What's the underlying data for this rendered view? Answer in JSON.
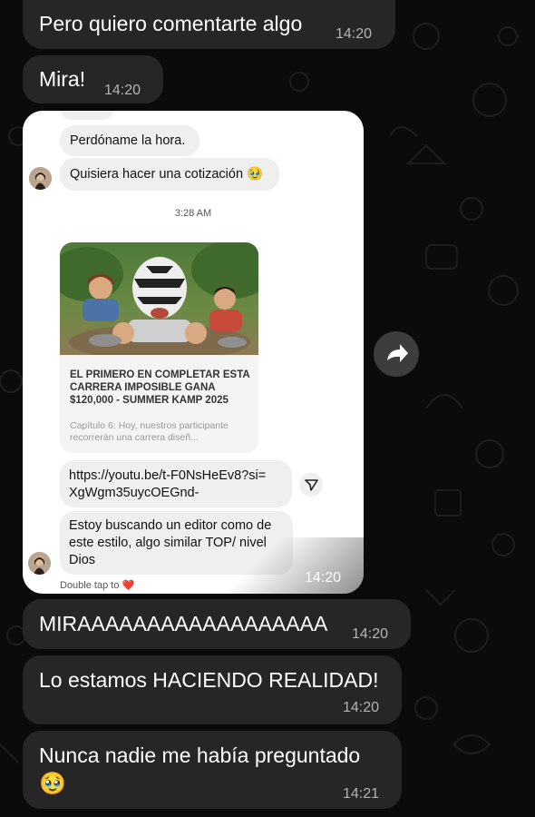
{
  "chat": {
    "messages": [
      {
        "text": "Pero quiero comentarte algo",
        "time": "14:20"
      },
      {
        "text": "Mira!",
        "time": "14:20"
      },
      {
        "text": "MIRAAAAAAAAAAAAAAAAAA",
        "time": "14:20"
      },
      {
        "text": "Lo estamos HACIENDO REALIDAD!",
        "time": "14:20"
      },
      {
        "text": "Nunca nadie me había preguntado",
        "emoji": "🥹",
        "time": "14:21"
      }
    ],
    "shared_image_time": "14:20"
  },
  "screenshot": {
    "msg1": "Perdóname la hora.",
    "msg2": "Quisiera hacer una cotización 🥹",
    "timestamp": "3:28 AM",
    "link_preview": {
      "title": "EL PRIMERO EN COMPLETAR ESTA CARRERA IMPOSIBLE GANA $120,000 - SUMMER KAMP 2025",
      "description": "Capítulo 6: Hoy, nuestros participante recorrerán una carrera diseñ..."
    },
    "link_line1": "https://youtu.be/t-F0NsHeEv8?si=",
    "link_line2": "XgWgm35uycOEGnd-",
    "msg3_line1": "Estoy buscando un editor como de",
    "msg3_line2": "este estilo, algo similar TOP/ nivel",
    "msg3_line3": "Dios",
    "double_tap": "Double tap to ❤️"
  },
  "icons": {
    "share": "share-arrow-icon",
    "send": "send-icon",
    "avatar": "avatar"
  },
  "colors": {
    "background": "#0b0b0b",
    "bubble": "#262626",
    "timestamp": "#b4b4b4"
  }
}
